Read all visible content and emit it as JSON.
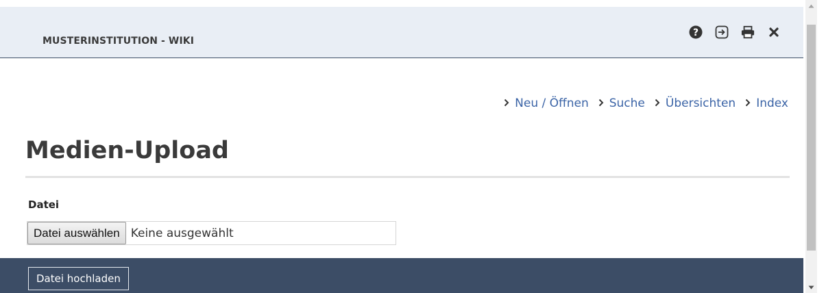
{
  "header": {
    "title": "MUSTERINSTITUTION - WIKI",
    "icons": [
      "help-icon",
      "login-icon",
      "print-icon",
      "close-icon"
    ]
  },
  "nav": {
    "links": [
      "Neu / Öffnen",
      "Suche",
      "Übersichten",
      "Index"
    ]
  },
  "page": {
    "title": "Medien-Upload"
  },
  "form": {
    "file_label": "Datei",
    "choose_button": "Datei auswählen",
    "no_file_selected": "Keine ausgewählt",
    "upload_button": "Datei hochladen"
  },
  "colors": {
    "header_bg": "#e9eef5",
    "link": "#3a63a6",
    "footer_bg": "#3c4d66"
  }
}
